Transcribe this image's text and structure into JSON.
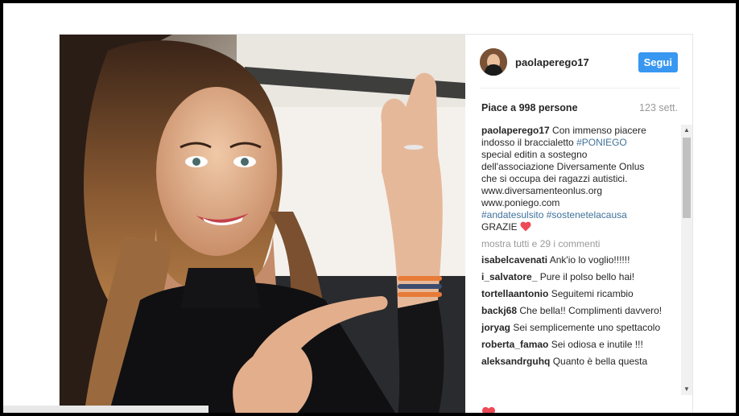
{
  "post": {
    "username": "paolaperego17",
    "follow_label": "Segui",
    "likes": "Piace a 998 persone",
    "age": "123 sett.",
    "caption": {
      "user": "paolaperego17",
      "lines": [
        "Con immenso piacere",
        "indosso il braccialetto",
        "#PONIEGO",
        "special editin a sostegno",
        "dell'associazione Diversamente Onlus",
        "che si occupa dei ragazzi autistici.",
        "www.diversamenteonlus.org",
        "www.poniego.com",
        "#andatesulsito",
        "#sostenetelacausa",
        "GRAZIE"
      ]
    },
    "more_comments": "mostra tutti e 29 i commenti",
    "comments": [
      {
        "user": "isabelcavenati",
        "text": "Ank'io lo voglio!!!!!!"
      },
      {
        "user": "i_salvatore_",
        "text": "Pure il polso bello hai!"
      },
      {
        "user": "tortellaantonio",
        "text": "Seguitemi ricambio"
      },
      {
        "user": "backj68",
        "text": "Che bella!! Complimenti davvero!"
      },
      {
        "user": "joryag",
        "text": "Sei semplicemente uno spettacolo"
      },
      {
        "user": "roberta_famao",
        "text": "Sei odiosa e inutile !!!"
      },
      {
        "user": "aleksandrguhq",
        "text": "Quanto è bella questa"
      }
    ]
  },
  "colors": {
    "follow_bg": "#3897f0",
    "hashtag": "#3f729b",
    "heart": "#ed4956"
  },
  "icons": {
    "heart": "heart-icon",
    "scroll_up": "arrow-up-icon",
    "scroll_down": "arrow-down-icon"
  }
}
